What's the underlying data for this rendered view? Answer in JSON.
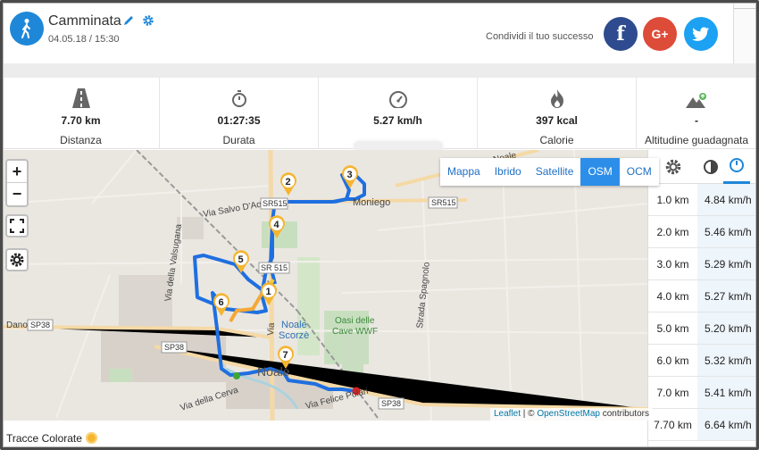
{
  "activity": {
    "title": "Camminata",
    "datetime": "04.05.18 / 15:30",
    "icon": "walking-person-icon",
    "accent": "#1f87d8"
  },
  "share": {
    "text": "Condividi il tuo successo",
    "facebook_label": "f",
    "googleplus_label": "G+",
    "colors": {
      "facebook": "#2d4b8e",
      "googleplus": "#dd4b39",
      "twitter": "#1da1f2"
    }
  },
  "stats": [
    {
      "icon": "road-icon",
      "value": "7.70 km",
      "label": "Distanza"
    },
    {
      "icon": "stopwatch-icon",
      "value": "01:27:35",
      "label": "Durata"
    },
    {
      "icon": "speedometer-icon",
      "value": "5.27 km/h",
      "label": ""
    },
    {
      "icon": "flame-icon",
      "value": "397 kcal",
      "label": "Calorie"
    },
    {
      "icon": "mountain-icon",
      "value": "-",
      "label": "Altitudine guadagnata"
    }
  ],
  "map": {
    "layers": [
      "Mappa",
      "Ibrido",
      "Satellite",
      "OSM",
      "OCM"
    ],
    "active_layer": "OSM",
    "zoom_in": "+",
    "zoom_out": "−",
    "attribution": {
      "leaflet": "Leaflet",
      "sep": " | © ",
      "osm": "OpenStreetMap",
      "tail": " contributors"
    },
    "labels": {
      "moniego": "Moniego",
      "noale": "Noale",
      "scorze": "Scorzè",
      "noale_town": "Noale",
      "oasi_1": "Oasi delle",
      "oasi_2": "Cave WWF",
      "via_salvo": "Via Salvo D'Aquisto",
      "via_valsugana": "Via della Valsugana",
      "strada_spagnolo": "Strada Spagnolo",
      "via_cerva": "Via della Cerva",
      "via_felice": "Via Felice Polari",
      "via": "Via",
      "dano": "Dano",
      "sp38_a": "SP38",
      "sp38_b": "SP38",
      "sp38_c": "SP38",
      "sr515_a": "SR515",
      "sr515_b": "SR515",
      "sr515_c": "SR 515",
      "noale_top": "Noale"
    },
    "markers": [
      "1",
      "2",
      "3",
      "4",
      "5",
      "6",
      "7"
    ],
    "route_color": "#1f6fe0"
  },
  "footer": {
    "tracce": "Tracce Colorate"
  },
  "splits": [
    {
      "km": "1.0 km",
      "speed": "4.84 km/h"
    },
    {
      "km": "2.0 km",
      "speed": "5.46 km/h"
    },
    {
      "km": "3.0 km",
      "speed": "5.29 km/h"
    },
    {
      "km": "4.0 km",
      "speed": "5.27 km/h"
    },
    {
      "km": "5.0 km",
      "speed": "5.20 km/h"
    },
    {
      "km": "6.0 km",
      "speed": "5.32 km/h"
    },
    {
      "km": "7.0 km",
      "speed": "5.41 km/h"
    },
    {
      "km": "7.70 km",
      "speed": "6.64 km/h"
    }
  ]
}
